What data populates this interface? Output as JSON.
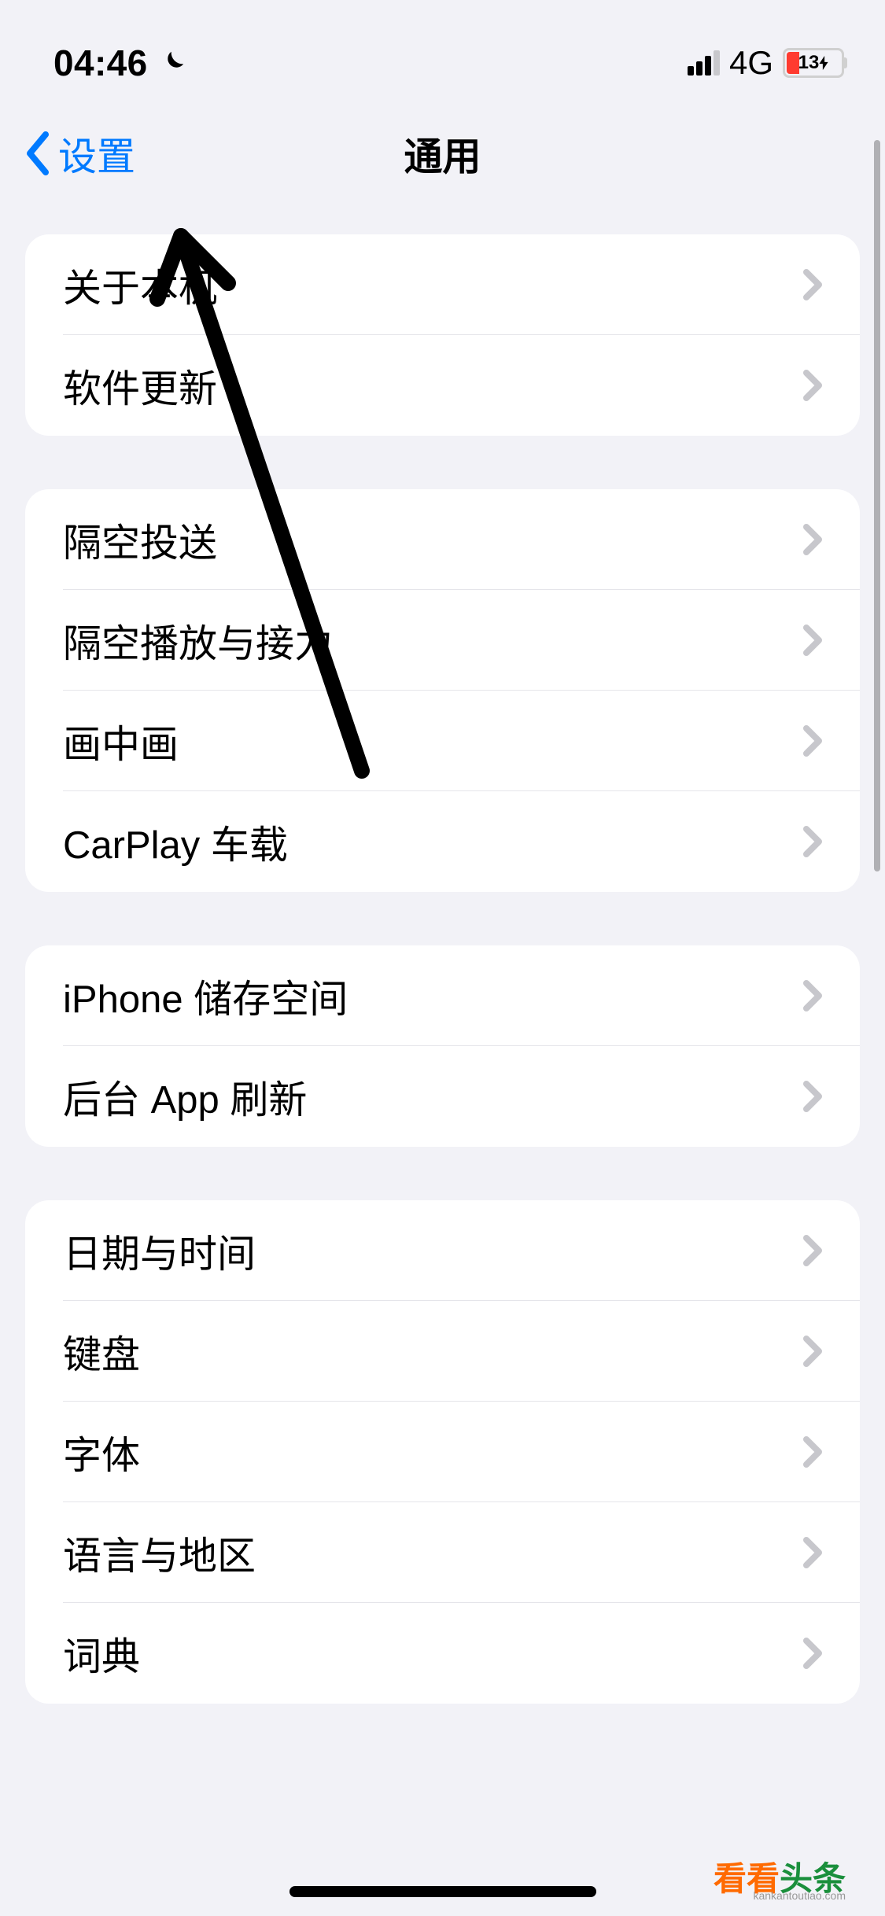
{
  "status": {
    "time": "04:46",
    "network": "4G",
    "battery": "13"
  },
  "nav": {
    "back": "设置",
    "title": "通用"
  },
  "sections": [
    {
      "rows": [
        {
          "label": "关于本机"
        },
        {
          "label": "软件更新"
        }
      ]
    },
    {
      "rows": [
        {
          "label": "隔空投送"
        },
        {
          "label": "隔空播放与接力"
        },
        {
          "label": "画中画"
        },
        {
          "label": "CarPlay 车载"
        }
      ]
    },
    {
      "rows": [
        {
          "label": "iPhone 储存空间"
        },
        {
          "label": "后台 App 刷新"
        }
      ]
    },
    {
      "rows": [
        {
          "label": "日期与时间"
        },
        {
          "label": "键盘"
        },
        {
          "label": "字体"
        },
        {
          "label": "语言与地区"
        },
        {
          "label": "词典"
        }
      ]
    }
  ],
  "watermark": {
    "brand1": "看看",
    "brand2": "头条",
    "url": "kankantoutiao.com"
  }
}
